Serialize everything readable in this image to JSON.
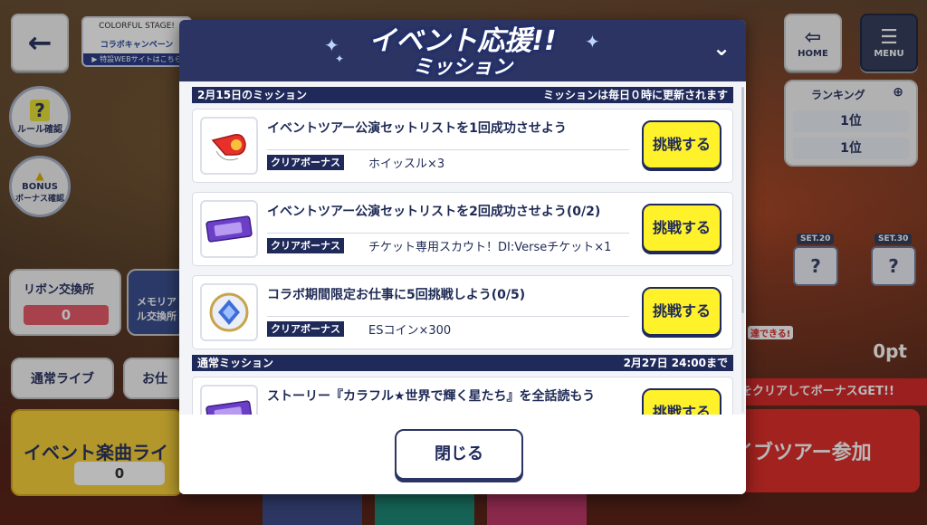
{
  "background": {
    "home_label": "HOME",
    "menu_label": "MENU",
    "collab_banner": {
      "line1": "COLORFUL STAGE!",
      "campaign": "コラボキャンペーン",
      "web_link": "▶ 特設WEBサイトはこちら"
    },
    "rule_button": {
      "symbol": "?",
      "label": "ルール確認"
    },
    "bonus_button": {
      "title": "BONUS",
      "label": "ボーナス確認"
    },
    "ribbon_exchange": {
      "label": "リボン交換所",
      "value": "0"
    },
    "memory_exchange": {
      "label": "メモリアル交換所"
    },
    "normal_live": "通常ライブ",
    "other_live": "お仕",
    "event_song": {
      "label": "イベント楽曲ライ",
      "count": "0"
    },
    "ranking": {
      "title": "ランキング",
      "rows": [
        "1位",
        "1位"
      ]
    },
    "sets": [
      "SET.20",
      "SET.30"
    ],
    "points": "0pt",
    "bonus_strip": "をクリアしてボーナスGET!!",
    "tour_button": "イブツアー参加",
    "clear_hint": "達できる!"
  },
  "modal": {
    "title_line1": "イベント応援!!",
    "title_line2": "ミッション",
    "sections": [
      {
        "left": "2月15日のミッション",
        "right": "ミッションは毎日０時に更新されます",
        "missions": [
          {
            "title": "イベントツアー公演セットリストを1回成功させよう",
            "bonus_label": "クリアボーナス",
            "bonus": "ホイッスル×3",
            "button": "挑戦する",
            "icon": "whistle-icon"
          },
          {
            "title": "イベントツアー公演セットリストを2回成功させよう(0/2)",
            "bonus_label": "クリアボーナス",
            "bonus": "チケット専用スカウト！DI:Verseチケット×1",
            "button": "挑戦する",
            "icon": "ticket-icon"
          },
          {
            "title": "コラボ期間限定お仕事に5回挑戦しよう(0/5)",
            "bonus_label": "クリアボーナス",
            "bonus": "ESコイン×300",
            "button": "挑戦する",
            "icon": "es-coin-icon"
          }
        ]
      },
      {
        "left": "通常ミッション",
        "right": "2月27日 24:00まで",
        "missions": [
          {
            "title": "ストーリー『カラフル★世界で輝く星たち』を全話読もう",
            "button": "挑戦する",
            "icon": "ticket-icon"
          }
        ]
      }
    ],
    "close_label": "閉じる"
  },
  "colors": {
    "navy": "#1f2a5a",
    "challenge_yellow": "#fff12a",
    "modal_bg": "#f3f4f7"
  }
}
